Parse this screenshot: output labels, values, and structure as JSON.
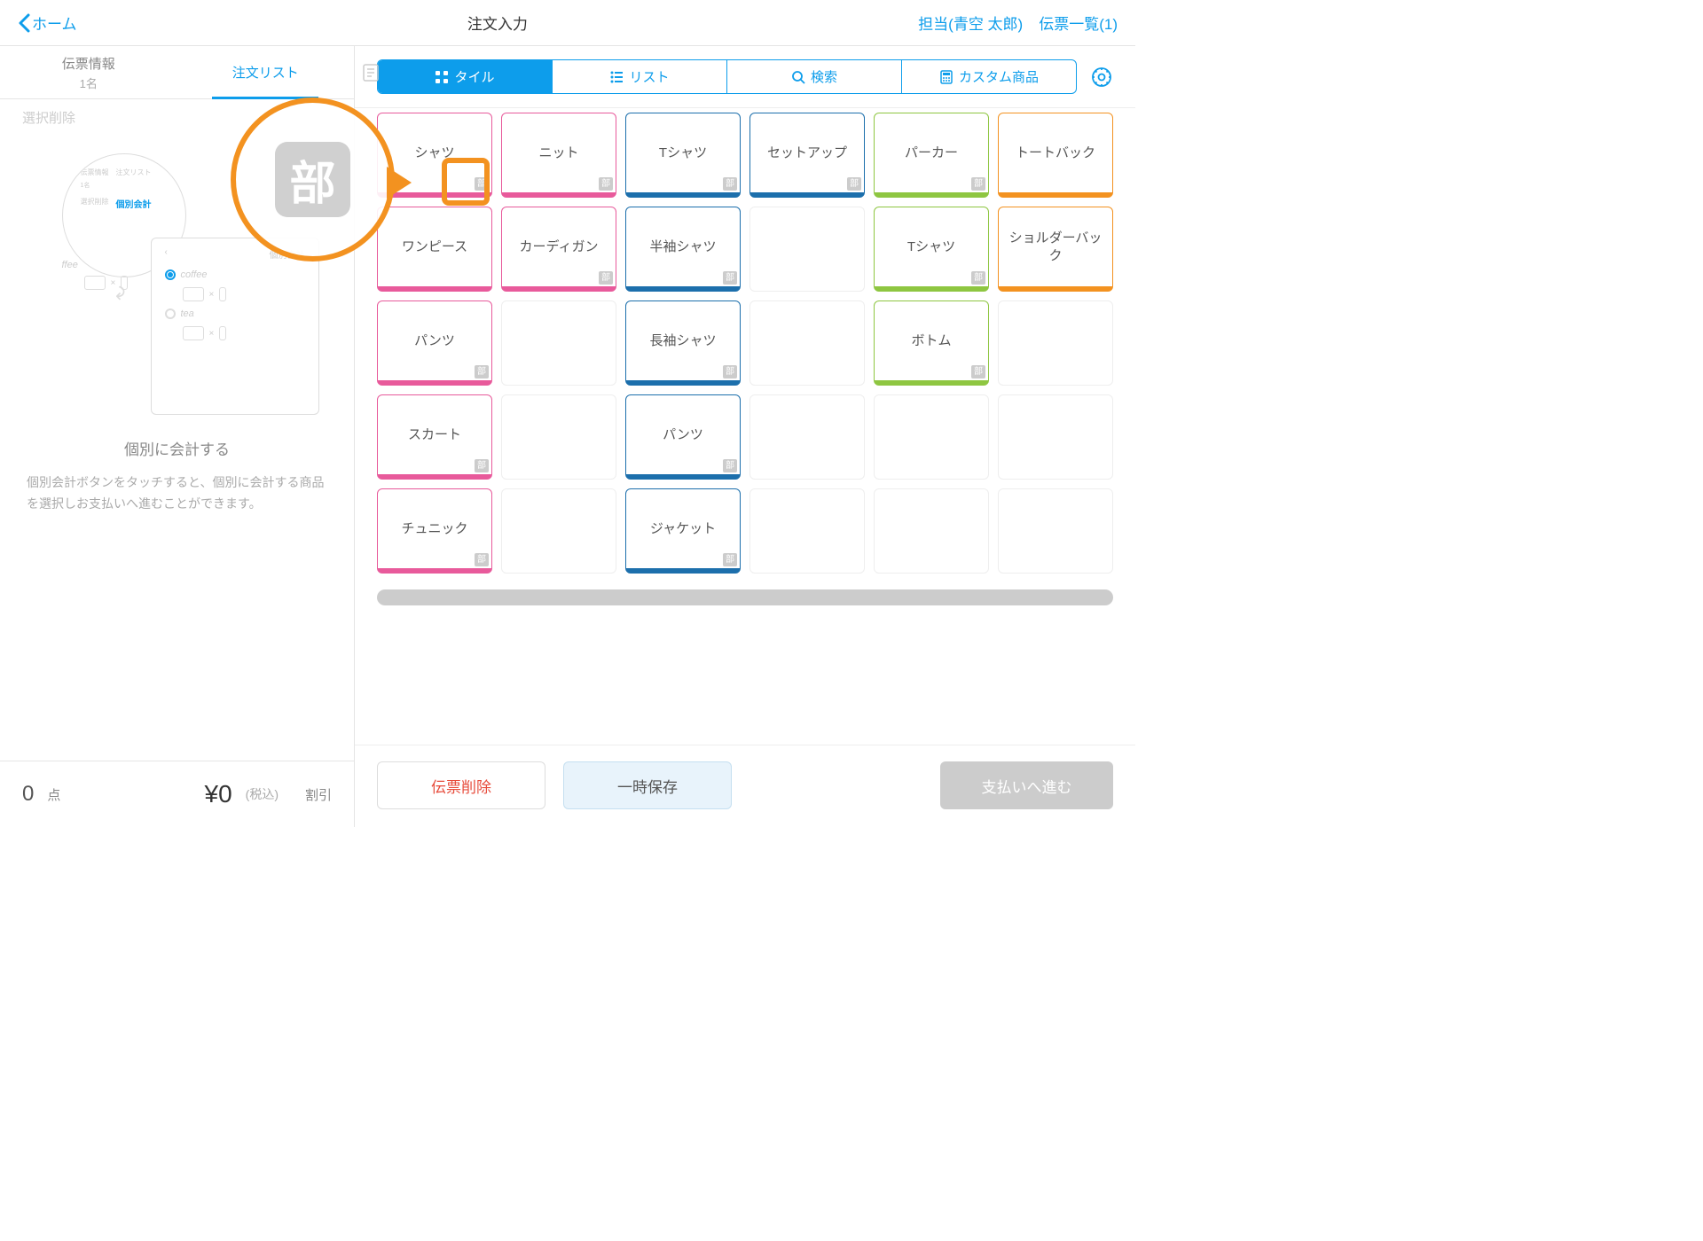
{
  "header": {
    "back_label": "ホーム",
    "title": "注文入力",
    "staff_label": "担当(青空 太郎)",
    "slips_label": "伝票一覧(1)"
  },
  "left_tabs": {
    "tab1_line1": "伝票情報",
    "tab1_line2": "1名",
    "tab2": "注文リスト"
  },
  "toolbar": {
    "select_delete": "選択削除"
  },
  "callout_badge": "部",
  "empty": {
    "title": "個別に会計する",
    "desc": "個別会計ボタンをタッチすると、個別に会計する商品を選択しお支払いへ進むことができます。",
    "illus": {
      "t1": "伝票情報",
      "t1s": "1名",
      "t2": "注文リスト",
      "ffee": "ffee",
      "panel_kobetsu": "個別会計",
      "panel_sentaku": "選択削除",
      "coffee": "coffee",
      "tea": "tea"
    }
  },
  "bottom_left": {
    "count": "0",
    "count_unit": "点",
    "price": "¥0",
    "tax": "(税込)",
    "discount": "割引"
  },
  "seg": {
    "tile": "タイル",
    "list": "リスト",
    "search": "検索",
    "custom": "カスタム商品"
  },
  "tile_badge": "部",
  "tiles": [
    [
      {
        "t": "シャツ",
        "c": "pink",
        "b": 1
      },
      {
        "t": "ニット",
        "c": "pink",
        "b": 1
      },
      {
        "t": "Tシャツ",
        "c": "blue",
        "b": 1
      },
      {
        "t": "セットアップ",
        "c": "blue",
        "b": 1
      },
      {
        "t": "パーカー",
        "c": "green",
        "b": 1
      },
      {
        "t": "トートバック",
        "c": "orange",
        "b": 0
      }
    ],
    [
      {
        "t": "ワンピース",
        "c": "pink",
        "b": 0
      },
      {
        "t": "カーディガン",
        "c": "pink",
        "b": 1
      },
      {
        "t": "半袖シャツ",
        "c": "blue",
        "b": 1
      },
      {
        "t": "",
        "c": "empty",
        "b": 0
      },
      {
        "t": "Tシャツ",
        "c": "green",
        "b": 1
      },
      {
        "t": "ショルダーバック",
        "c": "orange",
        "b": 0
      }
    ],
    [
      {
        "t": "パンツ",
        "c": "pink",
        "b": 1
      },
      {
        "t": "",
        "c": "empty",
        "b": 0
      },
      {
        "t": "長袖シャツ",
        "c": "blue",
        "b": 1
      },
      {
        "t": "",
        "c": "empty",
        "b": 0
      },
      {
        "t": "ボトム",
        "c": "green",
        "b": 1
      },
      {
        "t": "",
        "c": "empty",
        "b": 0
      }
    ],
    [
      {
        "t": "スカート",
        "c": "pink",
        "b": 1
      },
      {
        "t": "",
        "c": "empty",
        "b": 0
      },
      {
        "t": "パンツ",
        "c": "blue",
        "b": 1
      },
      {
        "t": "",
        "c": "empty",
        "b": 0
      },
      {
        "t": "",
        "c": "empty",
        "b": 0
      },
      {
        "t": "",
        "c": "empty",
        "b": 0
      }
    ],
    [
      {
        "t": "チュニック",
        "c": "pink",
        "b": 1
      },
      {
        "t": "",
        "c": "empty",
        "b": 0
      },
      {
        "t": "ジャケット",
        "c": "blue",
        "b": 1
      },
      {
        "t": "",
        "c": "empty",
        "b": 0
      },
      {
        "t": "",
        "c": "empty",
        "b": 0
      },
      {
        "t": "",
        "c": "empty",
        "b": 0
      }
    ]
  ],
  "actions": {
    "delete": "伝票削除",
    "save": "一時保存",
    "pay": "支払いへ進む"
  }
}
